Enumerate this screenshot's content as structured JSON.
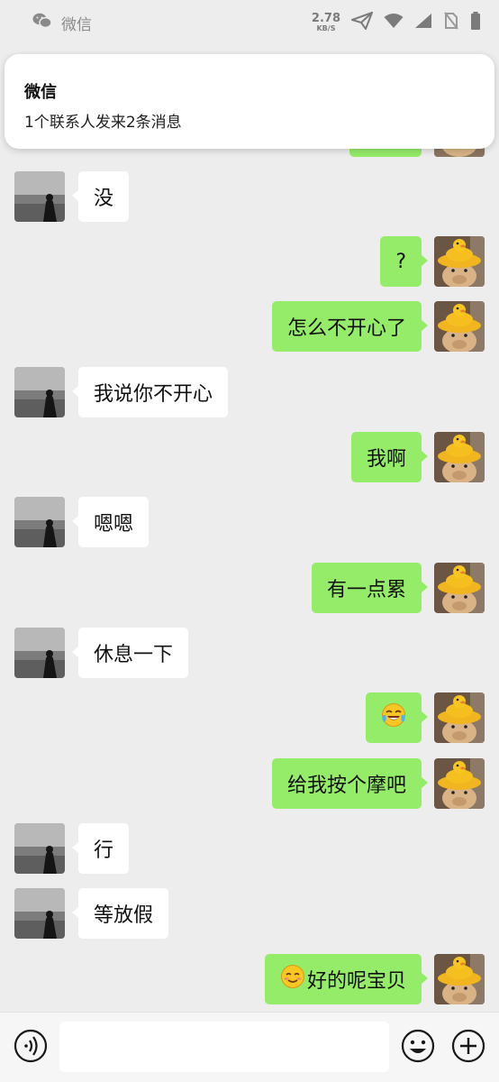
{
  "status_bar": {
    "app_name": "微信",
    "net_speed": "2.78",
    "net_unit": "KB/S"
  },
  "notification": {
    "title": "微信",
    "body": "1个联系人发来2条消息"
  },
  "messages": [
    {
      "side": "left",
      "text": "没"
    },
    {
      "side": "right",
      "text": "?"
    },
    {
      "side": "right",
      "text": "怎么不开心了"
    },
    {
      "side": "left",
      "text": "我说你不开心"
    },
    {
      "side": "right",
      "text": "我啊"
    },
    {
      "side": "left",
      "text": "嗯嗯"
    },
    {
      "side": "right",
      "text": "有一点累"
    },
    {
      "side": "left",
      "text": "休息一下"
    },
    {
      "side": "right",
      "emoji": "laughing-crying-emoji"
    },
    {
      "side": "right",
      "text": "给我按个摩吧"
    },
    {
      "side": "left",
      "text": "行"
    },
    {
      "side": "left",
      "text": "等放假"
    },
    {
      "side": "right",
      "emoji": "blushing-smile-emoji",
      "text": "好的呢宝贝"
    }
  ],
  "input_bar": {
    "placeholder": "",
    "icons": [
      "voice-icon",
      "emoji-icon",
      "plus-icon"
    ]
  },
  "colors": {
    "background": "#ededed",
    "bubble_self": "#95ec69",
    "bubble_other": "#ffffff"
  }
}
